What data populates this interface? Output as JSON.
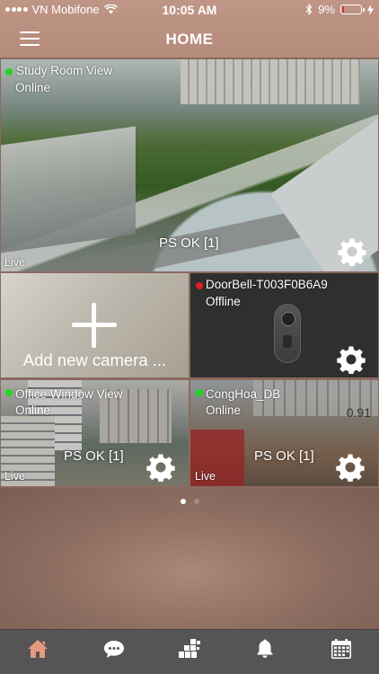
{
  "status_bar": {
    "carrier": "VN Mobifone",
    "time": "10:05 AM",
    "battery": "9%",
    "battery_fraction": 0.09
  },
  "header": {
    "title": "HOME"
  },
  "cameras": [
    {
      "name": "Study Room View",
      "status": "Online",
      "status_color": "#22d522",
      "ps": "PS OK [1]",
      "live": "Live"
    },
    {
      "name": "DoorBell-T003F0B6A9",
      "status": "Offline",
      "status_color": "#e01e1e"
    },
    {
      "name": "Office Window View",
      "status": "Online",
      "status_color": "#22d522",
      "ps": "PS OK [1]",
      "live": "Live"
    },
    {
      "name": "CongHoa_DB",
      "status": "Online",
      "status_color": "#22d522",
      "ps": "PS OK [1]",
      "live": "Live",
      "overlay": "0.91"
    }
  ],
  "add_camera": {
    "label": "Add new camera ..."
  },
  "pager": {
    "pages": 2,
    "active": 1,
    "active_color": "#ffffff",
    "inactive_color": "#a58a80"
  },
  "tabbar": {
    "items": [
      "home",
      "chat",
      "devices",
      "notifications",
      "calendar"
    ],
    "active": "home",
    "active_color": "#e59a7e",
    "inactive_color": "#ffffff"
  },
  "colors": {
    "header": "#b58b7b",
    "tabbar": "#555555"
  }
}
